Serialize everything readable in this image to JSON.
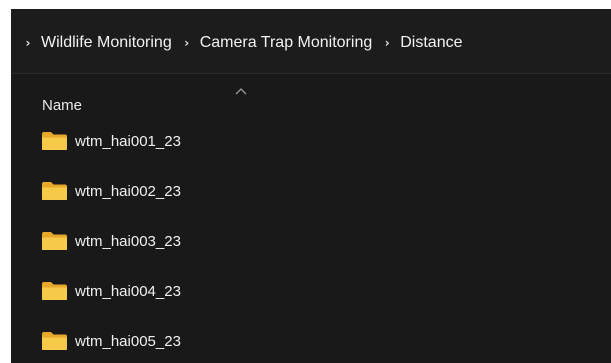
{
  "breadcrumb": {
    "separator": "›",
    "items": [
      "Wildlife Monitoring",
      "Camera Trap Monitoring",
      "Distance"
    ]
  },
  "column_header": {
    "label": "Name",
    "sort_icon": "chevron-up-icon"
  },
  "files": [
    {
      "name": "wtm_hai001_23",
      "icon": "folder-icon"
    },
    {
      "name": "wtm_hai002_23",
      "icon": "folder-icon"
    },
    {
      "name": "wtm_hai003_23",
      "icon": "folder-icon"
    },
    {
      "name": "wtm_hai004_23",
      "icon": "folder-icon"
    },
    {
      "name": "wtm_hai005_23",
      "icon": "folder-icon"
    }
  ],
  "colors": {
    "background": "#191919",
    "text": "#f0f0f0",
    "folder": "#f5c542"
  }
}
